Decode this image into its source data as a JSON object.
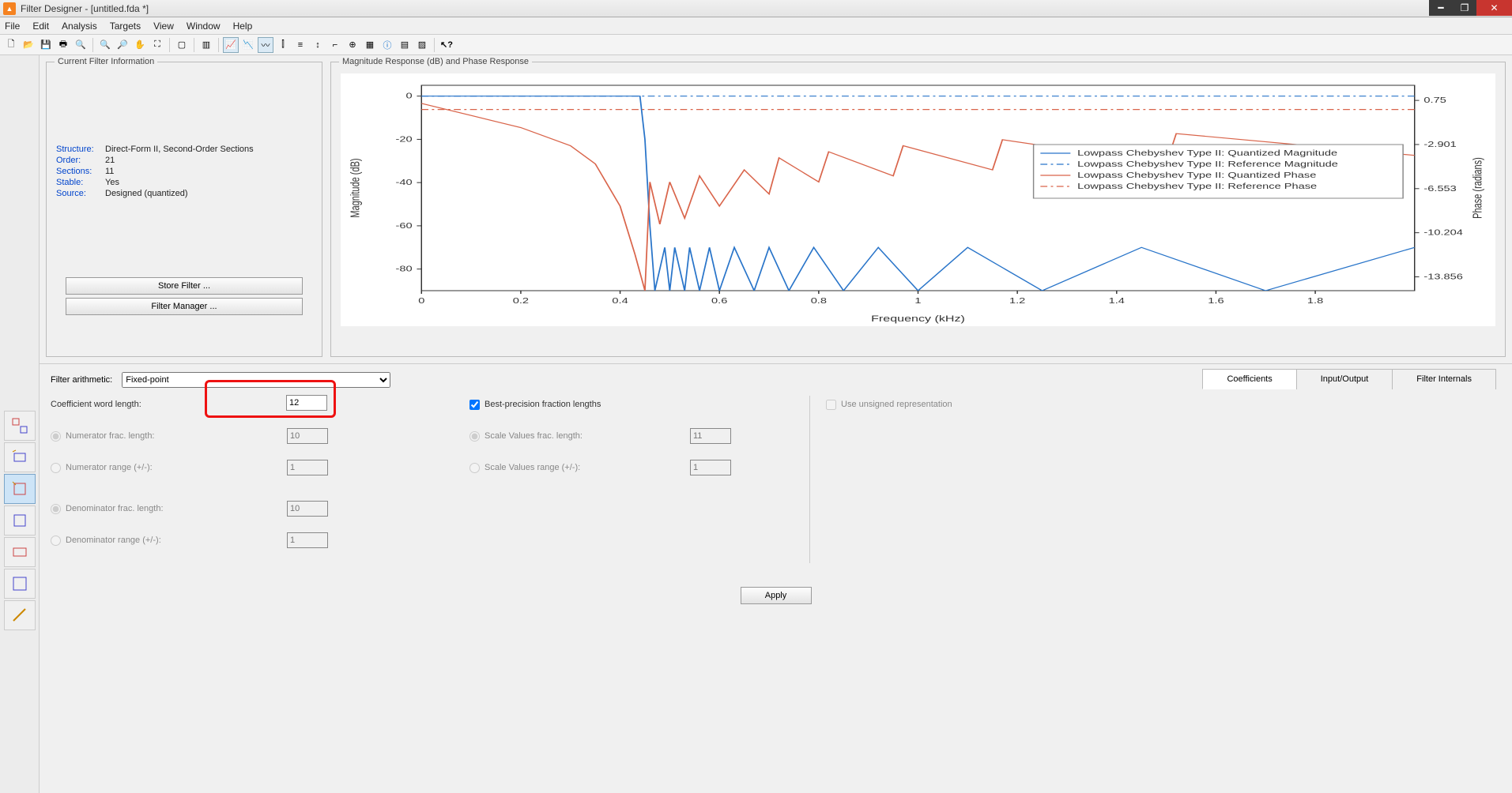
{
  "window": {
    "title": "Filter Designer -  [untitled.fda *]"
  },
  "menu": {
    "file": "File",
    "edit": "Edit",
    "analysis": "Analysis",
    "targets": "Targets",
    "view": "View",
    "window": "Window",
    "help": "Help"
  },
  "panels": {
    "filter_info_title": "Current Filter Information",
    "plot_title": "Magnitude Response (dB) and Phase Response"
  },
  "filter_info": {
    "structure_lbl": "Structure:",
    "structure_val": "Direct-Form II, Second-Order Sections",
    "order_lbl": "Order:",
    "order_val": "21",
    "sections_lbl": "Sections:",
    "sections_val": "11",
    "stable_lbl": "Stable:",
    "stable_val": "Yes",
    "source_lbl": "Source:",
    "source_val": "Designed (quantized)",
    "store_btn": "Store Filter ...",
    "mgr_btn": "Filter Manager ..."
  },
  "arithmetic": {
    "label": "Filter arithmetic:",
    "value": "Fixed-point"
  },
  "tabs": {
    "coef": "Coefficients",
    "io": "Input/Output",
    "internals": "Filter Internals"
  },
  "coef": {
    "word_len_lbl": "Coefficient word length:",
    "word_len_val": "12",
    "best_prec_lbl": "Best-precision fraction lengths",
    "num_frac_lbl": "Numerator frac. length:",
    "num_frac_val": "10",
    "num_range_lbl": "Numerator range (+/-):",
    "num_range_val": "1",
    "den_frac_lbl": "Denominator frac. length:",
    "den_frac_val": "10",
    "den_range_lbl": "Denominator range (+/-):",
    "den_range_val": "1",
    "sv_frac_lbl": "Scale Values frac. length:",
    "sv_frac_val": "11",
    "sv_range_lbl": "Scale Values range (+/-):",
    "sv_range_val": "1",
    "unsigned_lbl": "Use unsigned representation",
    "apply": "Apply"
  },
  "chart_data": {
    "type": "line",
    "xlabel": "Frequency (kHz)",
    "ylabel_left": "Magnitude (dB)",
    "ylabel_right": "Phase (radians)",
    "x_ticks": [
      0,
      0.2,
      0.4,
      0.6,
      0.8,
      1,
      1.2,
      1.4,
      1.6,
      1.8
    ],
    "y_left_ticks": [
      0,
      -20,
      -40,
      -60,
      -80
    ],
    "y_right_ticks": [
      0.75,
      -2.901,
      -6.553,
      -10.204,
      -13.856
    ],
    "xlim": [
      0,
      2.0
    ],
    "ylim_left": [
      -90,
      5
    ],
    "ylim_right": [
      -15,
      2
    ],
    "series": [
      {
        "name": "Lowpass Chebyshev Type II: Quantized Magnitude",
        "axis": "left",
        "color": "#2874c9",
        "style": "solid",
        "x": [
          0,
          0.1,
          0.2,
          0.3,
          0.4,
          0.44,
          0.45,
          0.46,
          0.47,
          0.49,
          0.5,
          0.51,
          0.53,
          0.54,
          0.56,
          0.58,
          0.6,
          0.63,
          0.67,
          0.7,
          0.74,
          0.79,
          0.85,
          0.92,
          1.0,
          1.1,
          1.25,
          1.45,
          1.7,
          2.0
        ],
        "y": [
          0,
          0,
          0,
          0,
          0,
          0,
          -20,
          -60,
          -90,
          -70,
          -90,
          -70,
          -90,
          -70,
          -90,
          -70,
          -90,
          -70,
          -90,
          -70,
          -90,
          -70,
          -90,
          -70,
          -90,
          -70,
          -90,
          -70,
          -90,
          -70
        ]
      },
      {
        "name": "Lowpass Chebyshev Type II: Reference Magnitude",
        "axis": "left",
        "color": "#2874c9",
        "style": "dashdot",
        "x": [
          0,
          2.0
        ],
        "y": [
          0,
          0
        ]
      },
      {
        "name": "Lowpass Chebyshev Type II: Quantized Phase",
        "axis": "right",
        "color": "#d9644a",
        "style": "solid",
        "x": [
          0,
          0.1,
          0.2,
          0.3,
          0.35,
          0.4,
          0.43,
          0.45,
          0.46,
          0.48,
          0.5,
          0.53,
          0.56,
          0.6,
          0.65,
          0.7,
          0.72,
          0.8,
          0.82,
          0.95,
          0.97,
          1.15,
          1.17,
          1.5,
          1.52,
          2.0
        ],
        "y": [
          0.5,
          -0.5,
          -1.5,
          -3,
          -4.5,
          -8,
          -12,
          -15,
          -6,
          -9.5,
          -6,
          -9,
          -5.5,
          -8,
          -5,
          -7,
          -4,
          -6,
          -3.5,
          -5.5,
          -3,
          -5,
          -2.5,
          -4.5,
          -2,
          -3.8
        ]
      },
      {
        "name": "Lowpass Chebyshev Type II: Reference Phase",
        "axis": "right",
        "color": "#d9644a",
        "style": "dashdot",
        "x": [
          0,
          2.0
        ],
        "y": [
          0,
          0
        ]
      }
    ],
    "legend": [
      "Lowpass Chebyshev Type II: Quantized Magnitude",
      "Lowpass Chebyshev Type II: Reference Magnitude",
      "Lowpass Chebyshev Type II: Quantized Phase",
      "Lowpass Chebyshev Type II: Reference Phase"
    ]
  }
}
